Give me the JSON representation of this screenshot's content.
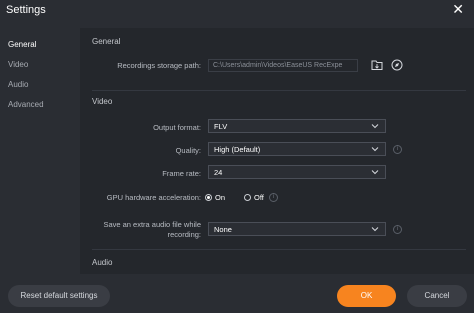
{
  "window": {
    "title": "Settings",
    "close_glyph": "✕"
  },
  "sidebar": {
    "items": [
      {
        "label": "General",
        "active": true
      },
      {
        "label": "Video",
        "active": false
      },
      {
        "label": "Audio",
        "active": false
      },
      {
        "label": "Advanced",
        "active": false
      }
    ]
  },
  "general": {
    "title": "General",
    "storage_label": "Recordings storage path:",
    "storage_value": "C:\\Users\\admin\\Videos\\EaseUS RecExpe",
    "folder_icon": "folder-icon",
    "open_icon": "compass-icon"
  },
  "video": {
    "title": "Video",
    "output_format_label": "Output format:",
    "output_format_value": "FLV",
    "quality_label": "Quality:",
    "quality_value": "High (Default)",
    "frame_rate_label": "Frame rate:",
    "frame_rate_value": "24",
    "gpu_label": "GPU hardware acceleration:",
    "gpu_on_label": "On",
    "gpu_off_label": "Off",
    "gpu_selected": "On",
    "extra_audio_label_line1": "Save an extra audio file while",
    "extra_audio_label_line2": "recording:",
    "extra_audio_value": "None",
    "info_glyph": "i"
  },
  "audio": {
    "title": "Audio"
  },
  "footer": {
    "reset_label": "Reset default settings",
    "ok_label": "OK",
    "cancel_label": "Cancel"
  },
  "colors": {
    "accent": "#f7841f",
    "background": "#2a2d33",
    "panel": "#24272c"
  }
}
